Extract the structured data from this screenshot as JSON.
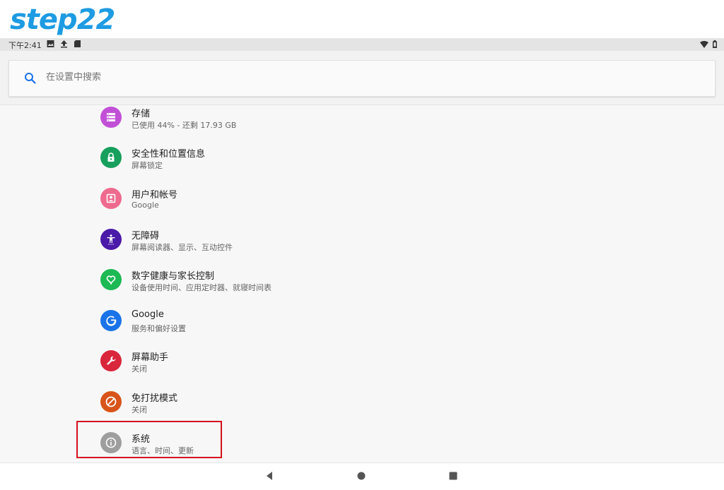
{
  "watermark": {
    "text": "step22"
  },
  "status_bar": {
    "time": "下午2:41",
    "icons": [
      "image-icon",
      "upload-icon",
      "sd-card-icon"
    ],
    "right_icons": [
      "wifi-icon",
      "battery-icon"
    ]
  },
  "search": {
    "placeholder": "在设置中搜索"
  },
  "settings": {
    "items": [
      {
        "title": "存储",
        "subtitle": "已使用 44% - 还剩 17.93 GB",
        "icon": "storage-icon",
        "color": "#c150d6"
      },
      {
        "title": "安全性和位置信息",
        "subtitle": "屏幕锁定",
        "icon": "lock-icon",
        "color": "#17a05d"
      },
      {
        "title": "用户和帐号",
        "subtitle": "Google",
        "icon": "account-icon",
        "color": "#ee6a8e"
      },
      {
        "title": "无障碍",
        "subtitle": "屏幕阅读器、显示、互动控件",
        "icon": "accessibility-icon",
        "color": "#4a1aa8"
      },
      {
        "title": "数字健康与家长控制",
        "subtitle": "设备使用时间、应用定时器、就寝时间表",
        "icon": "wellbeing-icon",
        "color": "#1db954"
      },
      {
        "title": "Google",
        "subtitle": "服务和偏好设置",
        "icon": "google-icon",
        "color": "#1a73e8"
      },
      {
        "title": "屏幕助手",
        "subtitle": "关闭",
        "icon": "wrench-icon",
        "color": "#d9263c"
      },
      {
        "title": "免打扰模式",
        "subtitle": "关闭",
        "icon": "do-not-disturb-icon",
        "color": "#d8541a"
      },
      {
        "title": "系统",
        "subtitle": "语言、时间、更新",
        "icon": "info-icon",
        "color": "#9e9e9e"
      }
    ]
  },
  "nav": {
    "buttons": [
      "back-icon",
      "home-icon",
      "recents-icon"
    ]
  }
}
